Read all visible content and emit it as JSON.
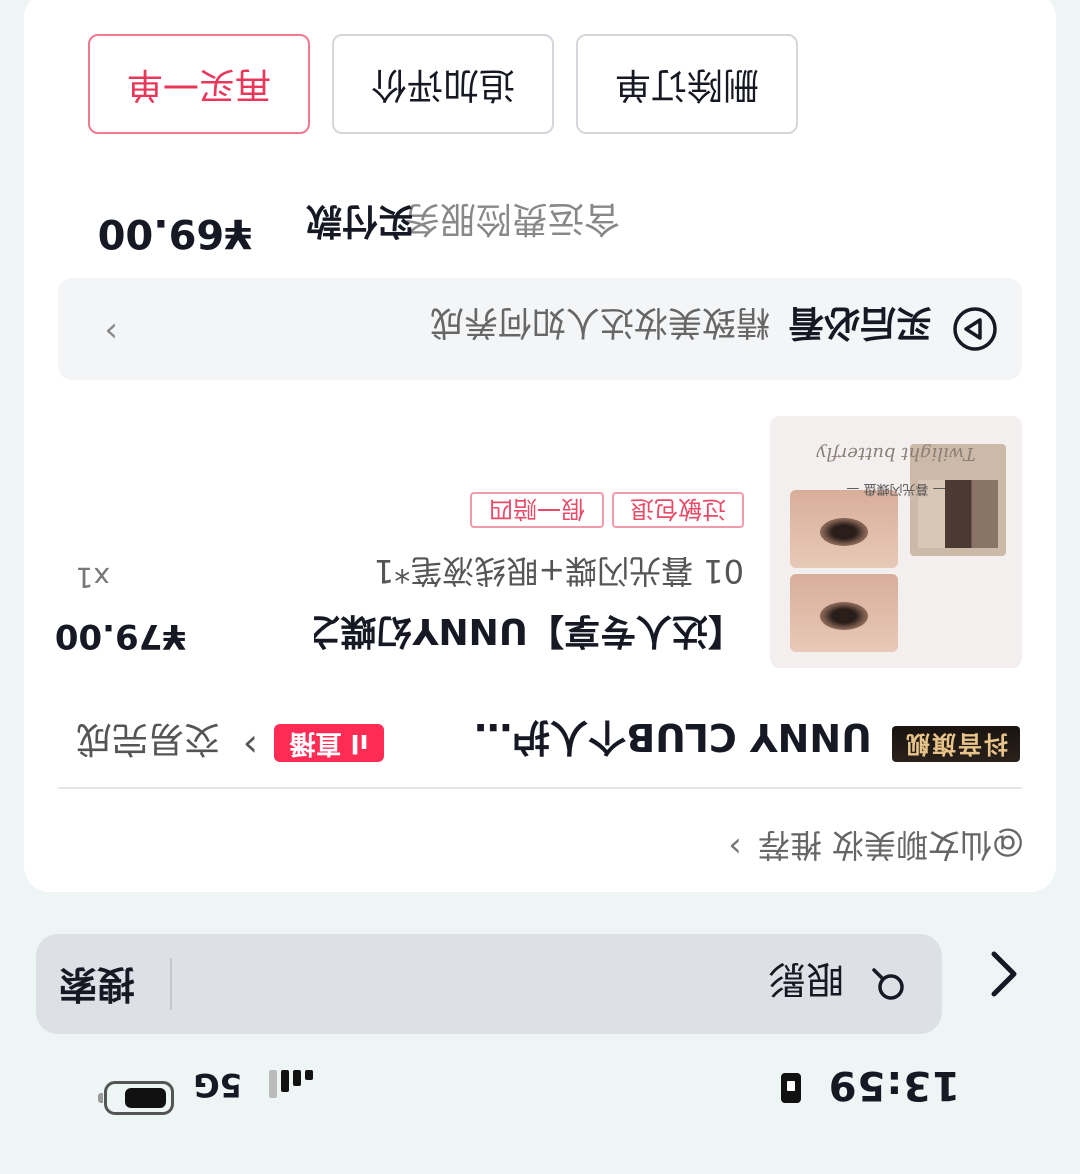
{
  "status_bar": {
    "time": "13:59",
    "network": "5G",
    "icons": [
      "sim-icon",
      "signal-icon",
      "battery-icon"
    ]
  },
  "search": {
    "query": "眼影",
    "button_label": "搜索",
    "icons": [
      "back-arrow-icon",
      "search-icon"
    ]
  },
  "recommend": {
    "label": "@仙女聊美妆 推荐",
    "chevron": "›"
  },
  "shop": {
    "badge": "抖音旗舰",
    "name": "UNNY CLUB个人护…",
    "live_badge": "直播",
    "status": "交易完成",
    "chevron": "›"
  },
  "product": {
    "title": "【达人专享】UNNY幻蝶之…",
    "price": "¥79.00",
    "spec": "01 暮光闪蝶+眼线液笔*1",
    "qty": "x1",
    "tags": [
      "过敏包退",
      "假一赔四"
    ],
    "thumb_caption": "— 暮光闪蝶盘 —",
    "thumb_script": "Twilight butterfly"
  },
  "tutorial": {
    "title": "买后必看",
    "subtitle": "精致美妆达人如何养成",
    "chevron": "›"
  },
  "payment": {
    "note": "含运费险服务",
    "label": "实付款",
    "amount": "¥69.00"
  },
  "actions": {
    "delete": "删除订单",
    "review": "追加评价",
    "rebuy": "再买一单"
  },
  "colors": {
    "accent": "#fe2c55",
    "rebuy_text": "#e8375a",
    "tag_text": "#e84a67",
    "background": "#eef5f5"
  }
}
